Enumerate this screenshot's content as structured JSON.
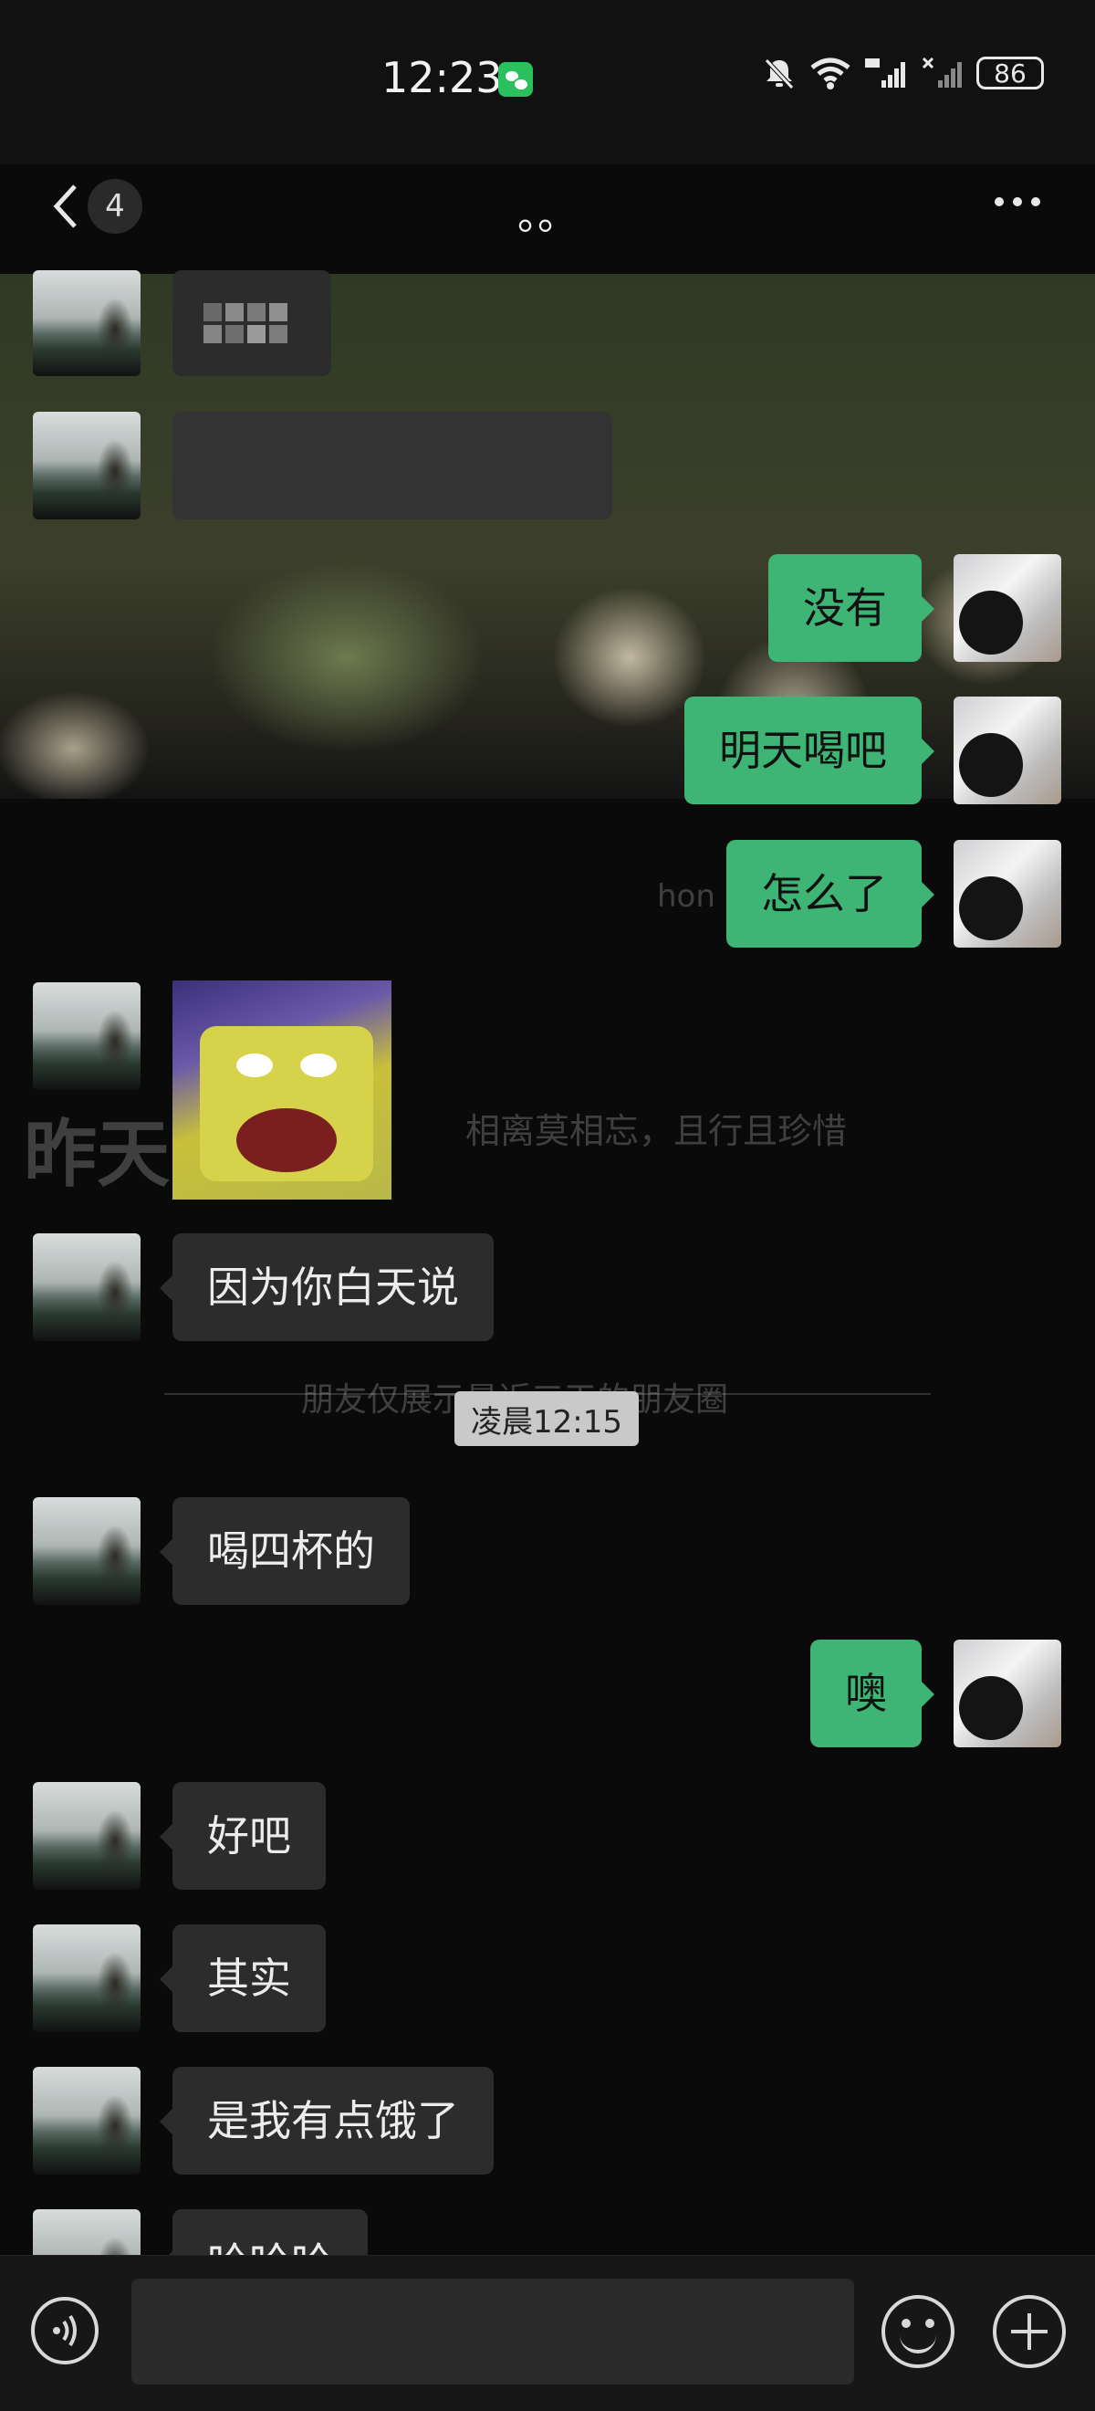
{
  "status_bar": {
    "time": "12:23",
    "battery": "86"
  },
  "header": {
    "unread_count": "4",
    "title": "。。"
  },
  "background_overlay": {
    "big_text": "昨天",
    "signature": "相离莫相忘，且行且珍惜",
    "moments_note": "朋友仅展示最近三天的朋友圈",
    "fragment": "hon"
  },
  "messages": [
    {
      "side": "left",
      "text": ""
    },
    {
      "side": "left",
      "text": ""
    },
    {
      "side": "right",
      "text": "没有"
    },
    {
      "side": "right",
      "text": "明天喝吧"
    },
    {
      "side": "right",
      "text": "怎么了"
    },
    {
      "side": "left",
      "type": "sticker"
    },
    {
      "side": "left",
      "text": "因为你白天说"
    },
    {
      "side": "left",
      "text": "喝四杯的"
    },
    {
      "side": "right",
      "text": "噢"
    },
    {
      "side": "left",
      "text": "好吧"
    },
    {
      "side": "left",
      "text": "其实"
    },
    {
      "side": "left",
      "text": "是我有点饿了"
    },
    {
      "side": "left",
      "text": "哈哈哈"
    }
  ],
  "timestamp": "凌晨12:15",
  "icons": {
    "back": "chevron-left-icon",
    "more": "more-icon",
    "voice": "voice-icon",
    "emoji": "emoji-icon",
    "plus": "plus-icon",
    "wechat": "wechat-icon"
  },
  "colors": {
    "sent_bubble": "#3eb575",
    "received_bubble": "#2c2c2c",
    "background": "#0a0a0a"
  }
}
